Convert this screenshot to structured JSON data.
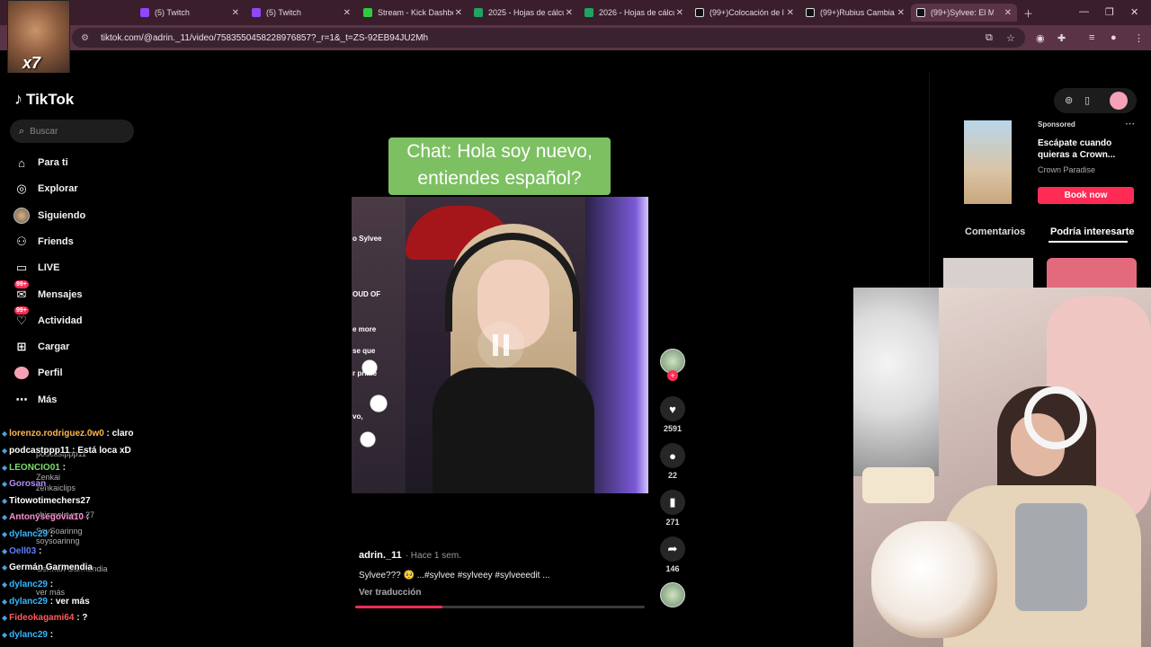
{
  "browser": {
    "tabs": [
      {
        "title": "(5) Twitch",
        "icon": "twitch"
      },
      {
        "title": "(5) Twitch",
        "icon": "twitch"
      },
      {
        "title": "Stream - Kick Dashbo",
        "icon": "kick"
      },
      {
        "title": "2025 - Hojas de cálcu",
        "icon": "sheets"
      },
      {
        "title": "2026 - Hojas de cálcu",
        "icon": "sheets"
      },
      {
        "title": "(99+)Colocación de l",
        "icon": "tiktok"
      },
      {
        "title": "(99+)Rubius Cambia",
        "icon": "tiktok"
      },
      {
        "title": "(99+)Sylvee: El M",
        "icon": "tiktok"
      }
    ],
    "url": "tiktok.com/@adrin._11/video/7583550458228976857?_r=1&_t=ZS-92EB94JU2Mh"
  },
  "webcam_label": "x7",
  "tiktok": {
    "logo": "TikTok",
    "search_placeholder": "Buscar",
    "nav": [
      {
        "label": "Para ti",
        "icon": "home-icon"
      },
      {
        "label": "Explorar",
        "icon": "compass-icon"
      },
      {
        "label": "Siguiendo",
        "icon": "avatar"
      },
      {
        "label": "Friends",
        "icon": "friends-icon"
      },
      {
        "label": "LIVE",
        "icon": "live-icon"
      },
      {
        "label": "Mensajes",
        "icon": "messages-icon",
        "badge": "99+"
      },
      {
        "label": "Actividad",
        "icon": "activity-icon",
        "badge": "99+"
      },
      {
        "label": "Cargar",
        "icon": "upload-icon"
      },
      {
        "label": "Perfil",
        "icon": "profile-icon"
      },
      {
        "label": "Más",
        "icon": "more-icon"
      }
    ],
    "video": {
      "caption_line1": "Chat: Hola soy nuevo,",
      "caption_line2": "entiendes español?",
      "side_texts": [
        "o Sylvee",
        "OUD OF",
        "e more",
        "se que",
        "r prime",
        "vo,"
      ],
      "author": "adrin._11",
      "time": "· Hace 1 sem.",
      "description": "Sylvee??? 🥺 ...#sylvee #sylveey #sylveeedit ...",
      "translate": "Ver traducción",
      "progress": 0.3
    },
    "actions": {
      "likes": "2591",
      "comments": "22",
      "saves": "271",
      "shares": "146"
    },
    "sidebar_right": {
      "sponsored": "Sponsored",
      "ad_title": "Escápate cuando quieras a Crown...",
      "ad_brand": "Crown Paradise",
      "ad_button": "Book now",
      "tab_comments": "Comentarios",
      "tab_interest": "Podría interesarte"
    }
  },
  "chat": [
    {
      "user": "lorenzo.rodriguez.0w0",
      "color": "#ffb84d",
      "msg": ": claro"
    },
    {
      "user": "podcastppp11",
      "color": "#ffffff",
      "msg": ": Está loca xD"
    },
    {
      "user": "LEONCIO01",
      "color": "#7ddc6a",
      "msg": ":"
    },
    {
      "user": "Gorosan",
      "color": "#b28cff",
      "msg": ""
    },
    {
      "user": "Titowotimechers27",
      "color": "#ffffff",
      "msg": ""
    },
    {
      "user": "Antonysegovia10",
      "color": "#ff8fd0",
      "msg": ":"
    },
    {
      "user": "dylanc29",
      "color": "#35b8ff",
      "msg": ":"
    },
    {
      "user": "Oell03",
      "color": "#5f7dff",
      "msg": ":"
    },
    {
      "user": "Germán Garmendia",
      "color": "#ffffff",
      "msg": ""
    },
    {
      "user": "dylanc29",
      "color": "#35b8ff",
      "msg": ":"
    },
    {
      "user": "dylanc29",
      "color": "#35b8ff",
      "msg": ": ver más"
    },
    {
      "user": "Fideokagami64",
      "color": "#ff5a5a",
      "msg": ": ?"
    },
    {
      "user": "dylanc29",
      "color": "#35b8ff",
      "msg": ":"
    }
  ],
  "chat_ghosts": [
    "podcastppp11",
    "Zenkai",
    "zenkaiclips",
    "chismelovers.27",
    "SoySoarinng",
    "soysoarinng",
    "German Garmendia",
    "ver más"
  ]
}
